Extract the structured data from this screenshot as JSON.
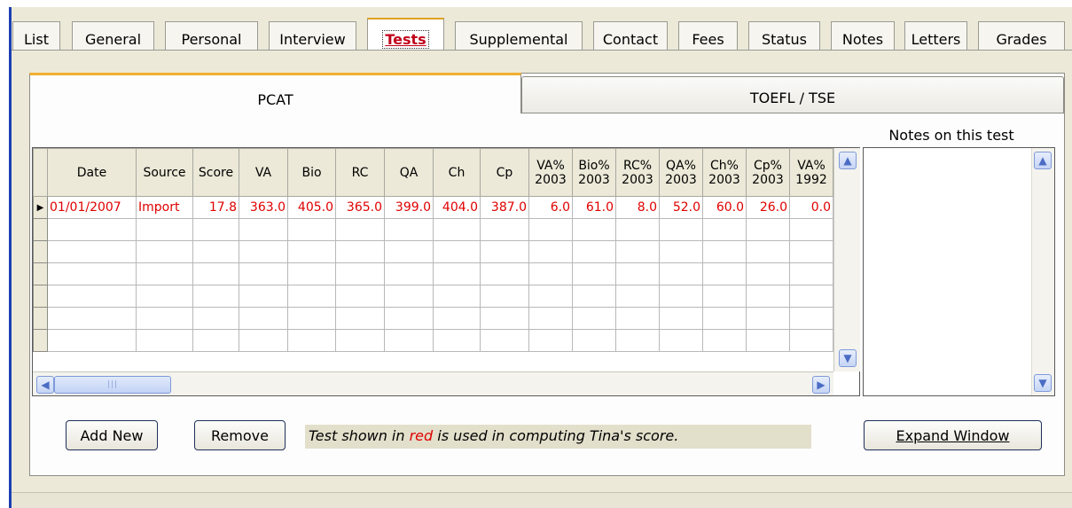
{
  "main_tabs": [
    {
      "label": "List",
      "active": false
    },
    {
      "label": "General",
      "active": false
    },
    {
      "label": "Personal",
      "active": false
    },
    {
      "label": "Interview",
      "active": false
    },
    {
      "label": "Tests",
      "active": true
    },
    {
      "label": "Supplemental",
      "active": false
    },
    {
      "label": "Contact",
      "active": false
    },
    {
      "label": "Fees",
      "active": false
    },
    {
      "label": "Status",
      "active": false
    },
    {
      "label": "Notes",
      "active": false
    },
    {
      "label": "Letters",
      "active": false
    },
    {
      "label": "Grades",
      "active": false
    }
  ],
  "sub_tabs": [
    {
      "label": "PCAT",
      "active": true
    },
    {
      "label": "TOEFL / TSE",
      "active": false
    }
  ],
  "grid": {
    "columns": [
      {
        "line1": "Date",
        "line2": ""
      },
      {
        "line1": "Source",
        "line2": ""
      },
      {
        "line1": "Score",
        "line2": ""
      },
      {
        "line1": "VA",
        "line2": ""
      },
      {
        "line1": "Bio",
        "line2": ""
      },
      {
        "line1": "RC",
        "line2": ""
      },
      {
        "line1": "QA",
        "line2": ""
      },
      {
        "line1": "Ch",
        "line2": ""
      },
      {
        "line1": "Cp",
        "line2": ""
      },
      {
        "line1": "VA%",
        "line2": "2003"
      },
      {
        "line1": "Bio%",
        "line2": "2003"
      },
      {
        "line1": "RC%",
        "line2": "2003"
      },
      {
        "line1": "QA%",
        "line2": "2003"
      },
      {
        "line1": "Ch%",
        "line2": "2003"
      },
      {
        "line1": "Cp%",
        "line2": "2003"
      },
      {
        "line1": "VA%",
        "line2": "1992"
      }
    ],
    "rows": [
      [
        "01/01/2007",
        "Import",
        "17.8",
        "363.0",
        "405.0",
        "365.0",
        "399.0",
        "404.0",
        "387.0",
        "6.0",
        "61.0",
        "8.0",
        "52.0",
        "60.0",
        "26.0",
        "0.0"
      ]
    ],
    "empty_rows": 6,
    "current_row_marker": "▶",
    "row_color": "#e00000"
  },
  "notes": {
    "label": "Notes on this test",
    "text": ""
  },
  "buttons": {
    "add_new": "Add New",
    "remove": "Remove",
    "expand_window": "Expand Window"
  },
  "message": {
    "before": "Test shown in ",
    "highlight": "red",
    "after": " is used in computing Tina's score."
  },
  "icons": {
    "scroll_up": "chevron-up-icon",
    "scroll_down": "chevron-down-icon",
    "scroll_left": "chevron-left-icon",
    "scroll_right": "chevron-right-icon"
  },
  "colors": {
    "active_tab_text": "#c0001a",
    "accent_tab_border": "#e0a220",
    "highlight_text": "#e00000",
    "window_edge": "#1b3fb3"
  }
}
